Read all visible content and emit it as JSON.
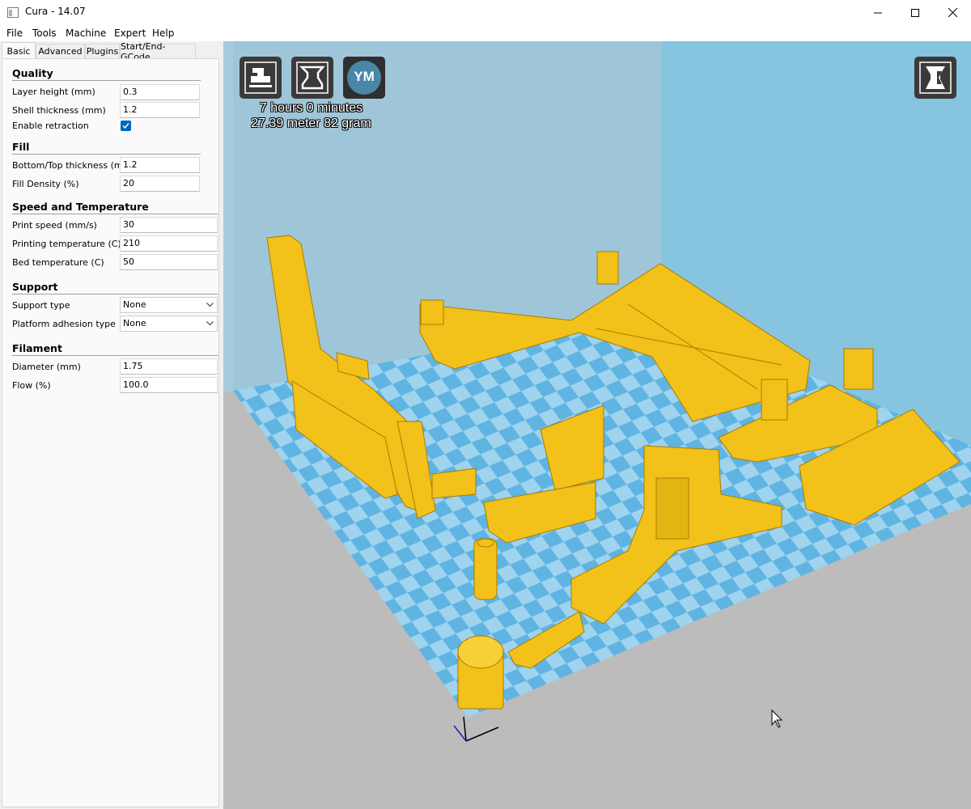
{
  "window": {
    "title": "Cura - 14.07"
  },
  "menu": [
    "File",
    "Tools",
    "Machine",
    "Expert",
    "Help"
  ],
  "tabs": [
    "Basic",
    "Advanced",
    "Plugins",
    "Start/End-GCode"
  ],
  "sections": {
    "quality": {
      "title": "Quality",
      "layer_height": {
        "label": "Layer height (mm)",
        "value": "0.3"
      },
      "shell_thickness": {
        "label": "Shell thickness (mm)",
        "value": "1.2"
      },
      "enable_retraction": {
        "label": "Enable retraction",
        "checked": true
      }
    },
    "fill": {
      "title": "Fill",
      "bottom_top": {
        "label": "Bottom/Top thickness (mm)",
        "value": "1.2"
      },
      "density": {
        "label": "Fill Density (%)",
        "value": "20"
      }
    },
    "speed": {
      "title": "Speed and Temperature",
      "print_speed": {
        "label": "Print speed (mm/s)",
        "value": "30"
      },
      "print_temp": {
        "label": "Printing temperature (C)",
        "value": "210"
      },
      "bed_temp": {
        "label": "Bed temperature (C)",
        "value": "50"
      }
    },
    "support": {
      "title": "Support",
      "support_type": {
        "label": "Support type",
        "value": "None"
      },
      "adhesion": {
        "label": "Platform adhesion type",
        "value": "None"
      }
    },
    "filament": {
      "title": "Filament",
      "diameter": {
        "label": "Diameter (mm)",
        "value": "1.75"
      },
      "flow": {
        "label": "Flow (%)",
        "value": "100.0"
      }
    }
  },
  "viewport": {
    "stats_time": "7 hours 0 minutes",
    "stats_material": "27.39 meter 82 gram",
    "ym_label": "YM",
    "model_color": "#f2c11a",
    "bed_light": "#9fd3ee",
    "bed_dark": "#5fb4e2",
    "back_wall": "#9fc6d8",
    "side_wall": "#86c4df"
  }
}
